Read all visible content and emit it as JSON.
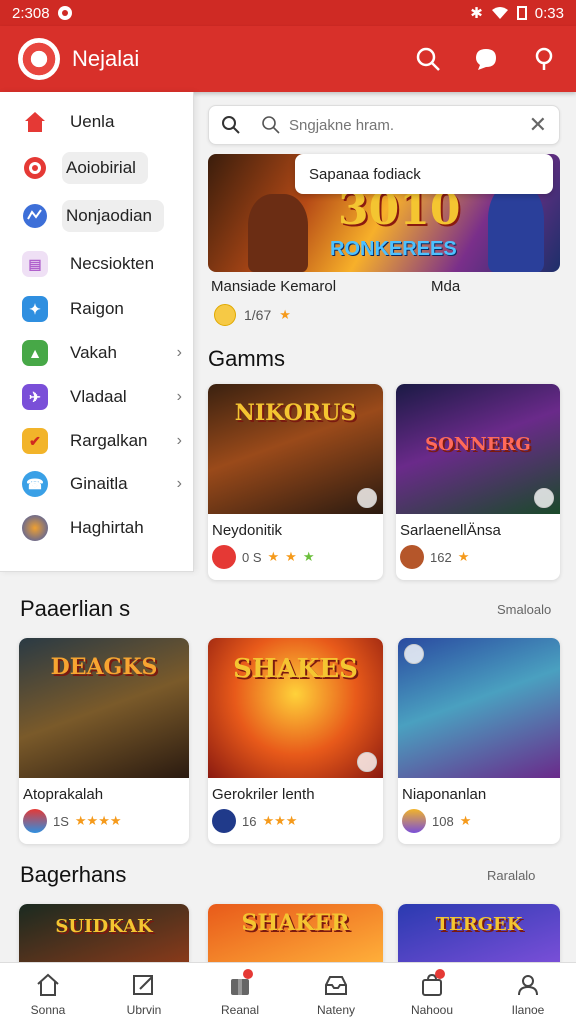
{
  "status_bar": {
    "time_left": "2:308",
    "time_right": "0:33"
  },
  "app_bar": {
    "title": "Nejalai"
  },
  "drawer": {
    "items": [
      {
        "label": "Uenla",
        "color": "#e53935",
        "icon": "home-icon"
      },
      {
        "label": "Aoiobirial",
        "color": "#e53935",
        "icon": "target-icon"
      },
      {
        "label": "Nonjaodian",
        "color": "#3d6fd8",
        "icon": "globe-icon"
      },
      {
        "label": "Necsiokten",
        "color": "#c77ad8",
        "icon": "document-icon"
      },
      {
        "label": "Raigon",
        "color": "#2f8fe0",
        "icon": "puzzle-icon"
      },
      {
        "label": "Vakah",
        "color": "#47a847",
        "icon": "map-icon"
      },
      {
        "label": "Vladaal",
        "color": "#7a4fd8",
        "icon": "plane-icon"
      },
      {
        "label": "Rargalkan",
        "color": "#f2b42a",
        "icon": "check-icon"
      },
      {
        "label": "Ginaitla",
        "color": "#3aa0e6",
        "icon": "chat-icon"
      },
      {
        "label": "Haghirtah",
        "color": "#f0a030",
        "icon": "avatar-icon"
      }
    ]
  },
  "search": {
    "placeholder": "Sngjakne hram."
  },
  "featured": {
    "banner_title": "3010",
    "banner_subtitle": "RONKEREES",
    "popup_text": "Sapanaa fodiack",
    "title_left": "Mansiade Kemarol",
    "title_right": "Mda",
    "rating": "1/67"
  },
  "sections": {
    "games": {
      "title": "Gamms",
      "cards": [
        {
          "name": "Neydonitik",
          "caption": "NIKORUS",
          "count": "0 S",
          "stars": 3
        },
        {
          "name": "SarlaenellÄnsa",
          "caption": "SONNERG",
          "count": "162",
          "stars": 1
        }
      ]
    },
    "popular": {
      "title": "Paaerlian s",
      "link": "Smaloalo",
      "cards": [
        {
          "name": "Atoprakalah",
          "caption": "DEAGKS",
          "count": "1S",
          "stars": 4
        },
        {
          "name": "Gerokriler lenth",
          "caption": "SHAKES",
          "count": "16",
          "stars": 3
        },
        {
          "name": "Niaponanlan",
          "caption": "",
          "count": "108",
          "stars": 1
        }
      ]
    },
    "bottom": {
      "title": "Bagerhans",
      "link": "Raralalo",
      "cards": [
        {
          "caption": "SUIDKAK"
        },
        {
          "caption": "SHAKER"
        },
        {
          "caption": "TERGEK"
        }
      ]
    }
  },
  "bottom_nav": [
    {
      "label": "Sonna",
      "icon": "home-icon"
    },
    {
      "label": "Ubrvin",
      "icon": "edit-icon"
    },
    {
      "label": "Reanal",
      "icon": "gift-icon",
      "dot": true
    },
    {
      "label": "Nateny",
      "icon": "inbox-icon"
    },
    {
      "label": "Nahoou",
      "icon": "bag-icon",
      "dot": true
    },
    {
      "label": "Ilanoe",
      "icon": "person-icon"
    }
  ]
}
